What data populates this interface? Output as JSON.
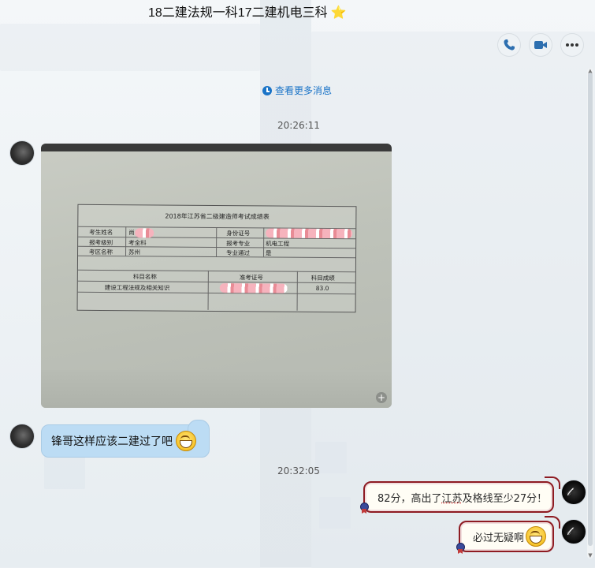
{
  "window": {
    "title": "18二建法规一科17二建机电三科",
    "title_star": "⭐"
  },
  "toolbar": {
    "call_icon": "phone-icon",
    "video_icon": "video-camera-icon",
    "more_icon": "more-dots-icon"
  },
  "history": {
    "more_messages_label": "查看更多消息"
  },
  "messages": [
    {
      "type": "timestamp",
      "text": "20:26:11"
    },
    {
      "type": "image",
      "side": "left",
      "image": {
        "doc_title": "2018年江苏省二级建造师考试成绩表",
        "fields": {
          "name_label": "考生姓名",
          "name_value": "尚",
          "id_label": "身份证号",
          "level_label": "报考级别",
          "level_value": "考全科",
          "major_label": "报考专业",
          "major_value": "机电工程",
          "region_label": "考区名称",
          "region_value": "苏州",
          "pass_label": "专业通过",
          "pass_value": "是"
        },
        "table_headers": [
          "科目名称",
          "准考证号",
          "科目成绩"
        ],
        "table_rows": [
          {
            "subject": "建设工程法规及相关知识",
            "ticket": "",
            "score": "83.0"
          }
        ]
      }
    },
    {
      "type": "text",
      "side": "left",
      "text": "锋哥这样应该二建过了吧"
    },
    {
      "type": "timestamp",
      "text": "20:32:05"
    },
    {
      "type": "text",
      "side": "right",
      "text_pre": "82分，高出了",
      "text_mark": "江苏",
      "text_post": "及格线至少27分！"
    },
    {
      "type": "text",
      "side": "right",
      "text": "必过无疑啊"
    }
  ],
  "colors": {
    "link": "#1a73c7",
    "left_bubble": "#bcdcf4",
    "right_bubble_border": "#8e1b22"
  }
}
